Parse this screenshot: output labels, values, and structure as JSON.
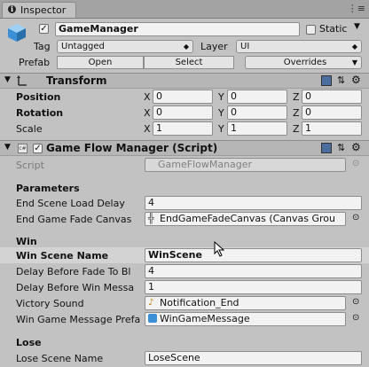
{
  "tab": {
    "label": "Inspector"
  },
  "header": {
    "object_name": "GameManager",
    "static_label": "Static",
    "tag_label": "Tag",
    "tag_value": "Untagged",
    "layer_label": "Layer",
    "layer_value": "UI",
    "prefab_label": "Prefab",
    "open_label": "Open",
    "select_label": "Select",
    "overrides_label": "Overrides"
  },
  "transform": {
    "title": "Transform",
    "rows": [
      {
        "label": "Position",
        "x": "0",
        "y": "0",
        "z": "0"
      },
      {
        "label": "Rotation",
        "x": "0",
        "y": "0",
        "z": "0"
      },
      {
        "label": "Scale",
        "x": "1",
        "y": "1",
        "z": "1"
      }
    ],
    "axis_x": "X",
    "axis_y": "Y",
    "axis_z": "Z"
  },
  "script_component": {
    "title": "Game Flow Manager (Script)",
    "script_label": "Script",
    "script_value": "GameFlowManager",
    "parameters_header": "Parameters",
    "end_delay_label": "End Scene Load Delay",
    "end_delay_value": "4",
    "fade_canvas_label": "End Game Fade Canvas",
    "fade_canvas_value": "EndGameFadeCanvas (Canvas Grou",
    "win_header": "Win",
    "win_scene_label": "Win Scene Name",
    "win_scene_value": "WinScene",
    "delay_fade_label": "Delay Before Fade To Bl",
    "delay_fade_value": "4",
    "delay_win_label": "Delay Before Win Messa",
    "delay_win_value": "1",
    "victory_sound_label": "Victory Sound",
    "victory_sound_value": "Notification_End",
    "win_prefab_label": "Win Game Message Prefa",
    "win_prefab_value": "WinGameMessage",
    "lose_header": "Lose",
    "lose_scene_label": "Lose Scene Name",
    "lose_scene_value": "LoseScene"
  },
  "colors": {
    "bg": "#c2c2c2",
    "header_bar": "#b6b6b6",
    "accent": "#3b8fd6"
  }
}
